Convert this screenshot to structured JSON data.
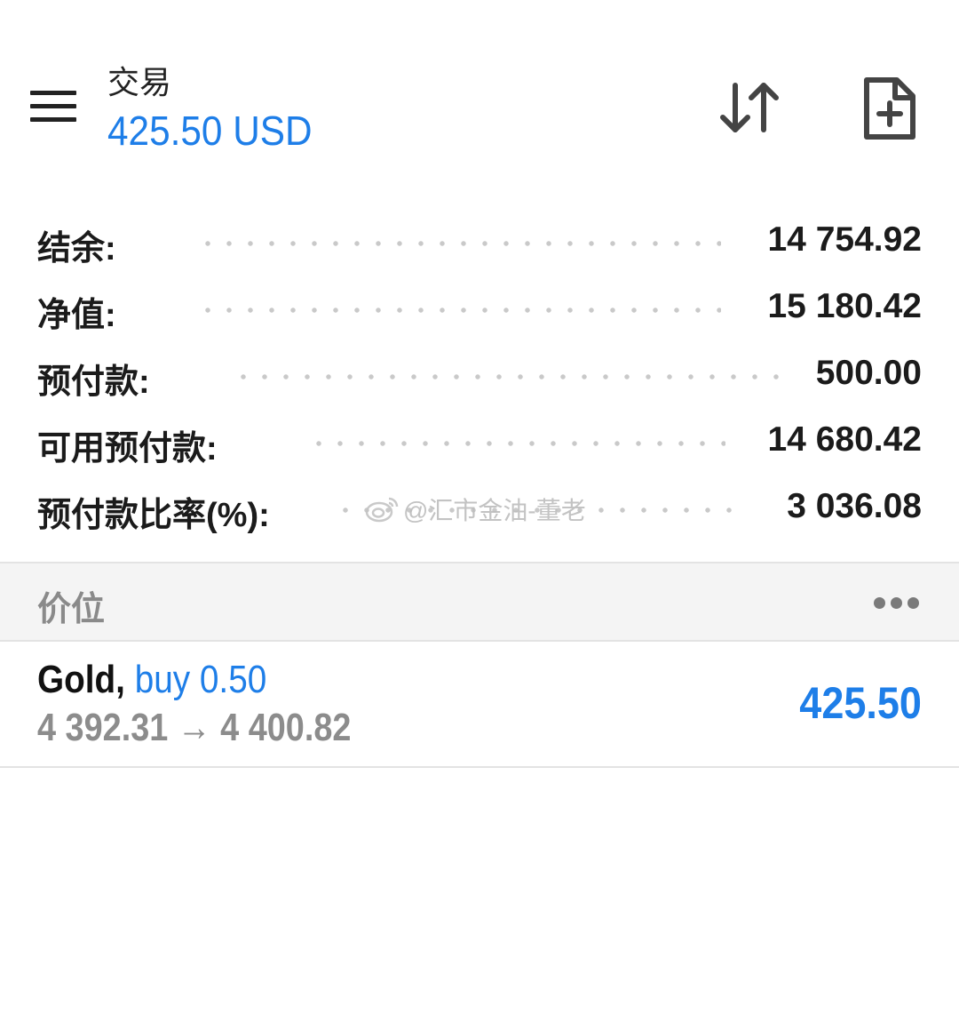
{
  "header": {
    "title": "交易",
    "balance": "425.50 USD",
    "icons": {
      "menu": "hamburger-menu-icon",
      "sort": "sort-arrows-icon",
      "new_order": "new-document-plus-icon"
    }
  },
  "summary": {
    "rows": [
      {
        "label": "结余:",
        "value": "14 754.92"
      },
      {
        "label": "净值:",
        "value": "15 180.42"
      },
      {
        "label": "预付款:",
        "value": "500.00"
      },
      {
        "label": "可用预付款:",
        "value": "14 680.42"
      },
      {
        "label": "预付款比率(%):",
        "value": "3 036.08"
      }
    ]
  },
  "watermark": {
    "text": "@汇市金油-董老"
  },
  "positions": {
    "section_title": "价位",
    "items": [
      {
        "symbol": "Gold,",
        "side": "buy 0.50",
        "price_change": "4 392.31 → 4 400.82",
        "profit": "425.50"
      }
    ]
  },
  "colors": {
    "accent": "#1e7ee8",
    "text": "#1b1b1b",
    "muted": "#8c8c8c",
    "section_bg": "#f4f4f4"
  }
}
